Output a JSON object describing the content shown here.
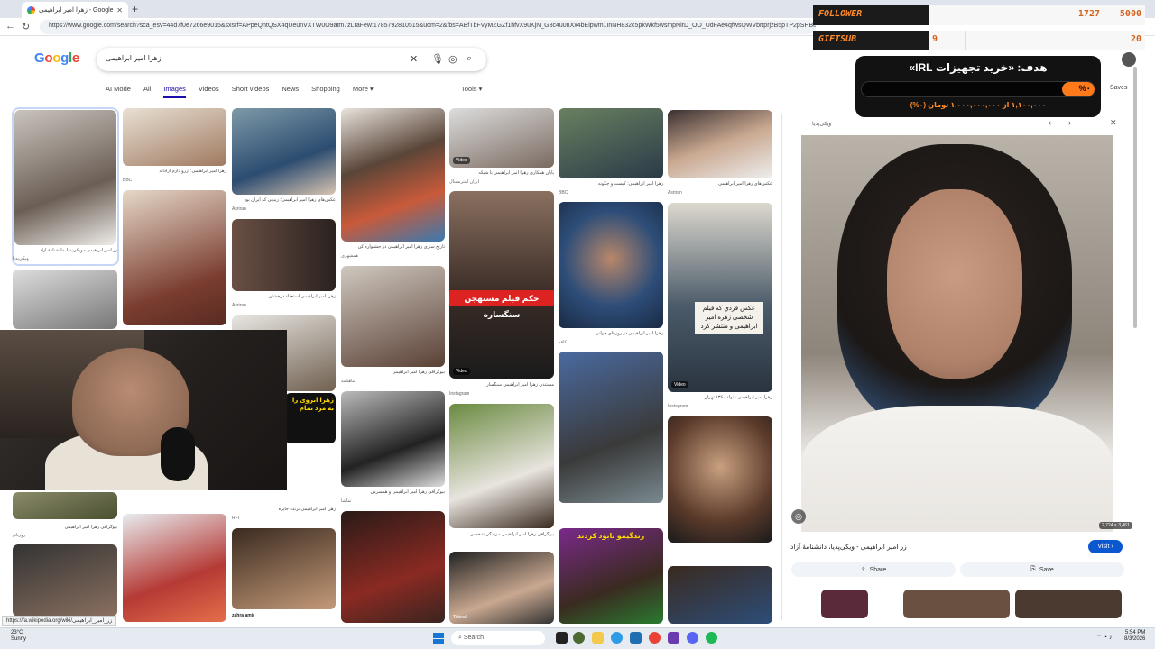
{
  "browser": {
    "tab_title": "زهرا امیر ابراهیمی - Google Search",
    "new_tab": "+",
    "url": "https://www.google.com/search?sca_esv=44d7f0e7266e9015&sxsrf=APpeQntQSX4qUeunVXTW0O9atm7zLraFew:1785792810515&udm=2&fbs=ABfTbFVyMZGZf1hfvX9uKjN_G8c4u0nXx4bElpwm1InNH832c5pkWkf5wsmpNlrD_OO_UdFAe4qfwsQWVbrtprjzB5pTP2pSHBuP2"
  },
  "google": {
    "logo": [
      "G",
      "o",
      "o",
      "g",
      "l",
      "e"
    ],
    "query": "زهرا امیر ابراهیمی",
    "filters": [
      "AI Mode",
      "All",
      "Images",
      "Videos",
      "Short videos",
      "News",
      "Shopping",
      "More ▾"
    ],
    "active_filter": "Images",
    "tools": "Tools ▾",
    "saves": "Saves"
  },
  "results": {
    "captions": [
      {
        "cap": "زر امیر ابراهیمی - ویکی‌پدیا، دانشنامهٔ آزاد",
        "src": "ویکی‌پدیا"
      },
      {
        "cap": "زهرا امیر ابراهیمی: آرزو دارم آزادانه",
        "src": "BBC"
      },
      {
        "cap": "عکس‌های زهرا امیر ابراهیمی؛ زیبایی که ایران بود",
        "src": "Asriran"
      },
      {
        "cap": "تاریخ سازی زهرا امیر ابراهیمی در جشنواره کن",
        "src": "همشهری"
      },
      {
        "cap": "پایان همکاری زهرا امیر ابراهیمی با شبکه",
        "src": "ایران اینترنشنال"
      },
      {
        "cap": "زهرا امیر ابراهیمی: کیست و چگونه",
        "src": "BBC"
      },
      {
        "cap": "عکس‌های زهرا امیر ابراهیمی",
        "src": "Asriran"
      },
      {
        "cap": "زهرا امیر ابراهیمی استعداد درخشان",
        "src": "Asriran"
      },
      {
        "cap": "بیوگرافی زهرا امیر ابراهیمی",
        "src": "ماهنامه"
      },
      {
        "cap": "مستندی زهرا امیر ابراهیمی سنگسار",
        "src": "Instagram"
      },
      {
        "cap": "زهرا امیر ابراهیمی در روزهای جوانی",
        "src": "کافه"
      },
      {
        "cap": "زهرا امیر ابراهیمی متولد ۱۳۶۰ تهران",
        "src": "Instagram"
      },
      {
        "cap": "بیوگرافی زهرا امیر ابراهیمی - زندگی شخصی",
        "src": "ستاره"
      },
      {
        "cap": "بیوگرافی زهرا امیر ابراهیمی و همسرش",
        "src": "نماشا"
      },
      {
        "cap": "زهرا امیر ابراهیمی برنده جایزه",
        "src": "RFI"
      },
      {
        "cap": "زهرا امیر ابراهیمی",
        "src": "zahra amir"
      },
      {
        "cap": "بیوگرافی زهرا امیر ابراهیمی",
        "src": "روزیاتو"
      },
      {
        "cap": "زهرا امیر ابراهیمی فرزند",
        "src": "Tabnak"
      }
    ],
    "video_label": "Video",
    "overlay_texts": {
      "blue_box": "عکس فردي كه فيلم شخصی زهره امیر ابراهیمی و منتشر كرد",
      "red_banner": "حکم فیلم مستهجن سنگساره",
      "yellow_banner": "زهرا ابروی را به مرد تمام",
      "green_banner": "زندگیمو نابود کردند"
    }
  },
  "panel": {
    "source": "ویکی‌پدیا",
    "dimensions": "2,724 × 3,461",
    "title": "زر امیر ابراهیمی - ویکی‌پدیا، دانشنامهٔ آزاد",
    "visit": "Visit ›",
    "share": "Share",
    "save": "Save"
  },
  "overlay": {
    "follower_label": "FOLLOWER",
    "follower_value": "1727",
    "follower_target": "5000",
    "follower_progress": 0.345,
    "giftsub_label": "GIFTSUB",
    "giftsub_value": "9",
    "giftsub_target": "20",
    "giftsub_progress": 0.45,
    "goal_title": "هدف: «خرید تجهیزات IRL»",
    "goal_percent": "%۰",
    "goal_text": "۱,۱۰۰,۰۰۰ از ۱,۰۰۰,۰۰۰,۰۰۰ تومان (۰%)",
    "goal_progress": 0.14
  },
  "statusbar_url": "https://fa.wikipedia.org/wiki/زر_امیر_ابراهیمی",
  "taskbar": {
    "temp": "23°C",
    "weather": "Sunny",
    "search": "Search",
    "time": "5:54 PM",
    "date": "8/3/2026"
  },
  "colors": {
    "accent": "#0b57d0",
    "overlay_orange": "#ff7a1a"
  }
}
